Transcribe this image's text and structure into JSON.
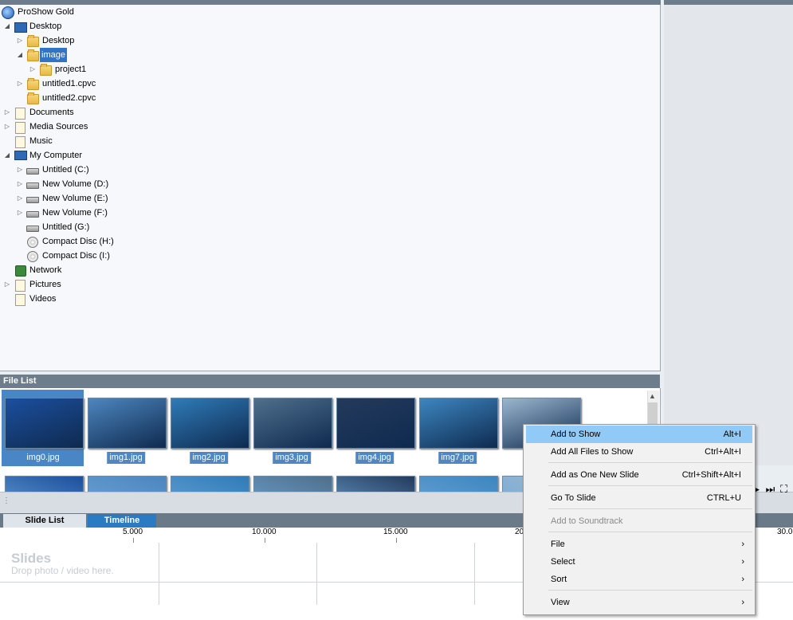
{
  "tree": [
    {
      "label": "ProShow Gold",
      "icon": "proshow-icon",
      "exp": ""
    },
    {
      "label": "Desktop",
      "icon": "desktop-icon",
      "exp": "◢"
    },
    {
      "label": "Desktop",
      "icon": "folder-icon",
      "exp": "▷"
    },
    {
      "label": "image",
      "icon": "folder-icon",
      "exp": "◢"
    },
    {
      "label": "project1",
      "icon": "folder-icon",
      "exp": "▷"
    },
    {
      "label": "untitled1.cpvc",
      "icon": "folder-icon",
      "exp": "▷"
    },
    {
      "label": "untitled2.cpvc",
      "icon": "folder-icon",
      "exp": ""
    },
    {
      "label": "Documents",
      "icon": "library-icon",
      "exp": "▷"
    },
    {
      "label": "Media Sources",
      "icon": "library-icon",
      "exp": "▷"
    },
    {
      "label": "Music",
      "icon": "library-icon",
      "exp": ""
    },
    {
      "label": "My Computer",
      "icon": "computer-icon",
      "exp": "◢"
    },
    {
      "label": "Untitled (C:)",
      "icon": "drive-icon",
      "exp": "▷"
    },
    {
      "label": "New Volume (D:)",
      "icon": "drive-icon",
      "exp": "▷"
    },
    {
      "label": "New Volume (E:)",
      "icon": "drive-icon",
      "exp": "▷"
    },
    {
      "label": "New Volume (F:)",
      "icon": "drive-icon",
      "exp": "▷"
    },
    {
      "label": "Untitled (G:)",
      "icon": "drive-icon",
      "exp": ""
    },
    {
      "label": "Compact Disc (H:)",
      "icon": "cd-icon",
      "exp": ""
    },
    {
      "label": "Compact Disc (I:)",
      "icon": "cd-icon",
      "exp": ""
    },
    {
      "label": "Network",
      "icon": "network-icon",
      "exp": ""
    },
    {
      "label": "Pictures",
      "icon": "library-icon",
      "exp": "▷"
    },
    {
      "label": "Videos",
      "icon": "library-icon",
      "exp": ""
    }
  ],
  "file_list": {
    "header": "File List",
    "files": [
      {
        "name": "img0.jpg",
        "color": "#1c4f9e"
      },
      {
        "name": "img1.jpg",
        "color": "#4d86bf"
      },
      {
        "name": "img2.jpg",
        "color": "#2f7bb8"
      },
      {
        "name": "img3.jpg",
        "color": "#4f6f8c"
      },
      {
        "name": "img4.jpg",
        "color": "#243a5c"
      },
      {
        "name": "img7.jpg",
        "color": "#3d86c0"
      },
      {
        "name": "",
        "color": "#9bb7cf"
      }
    ]
  },
  "tabs": {
    "slide_list": "Slide List",
    "timeline": "Timeline"
  },
  "ruler": [
    "5.000",
    "10.000",
    "15.000",
    "20",
    "30.0"
  ],
  "track": {
    "title": "Slides",
    "hint": "Drop photo / video here."
  },
  "transport": {
    "play": "▶",
    "end": "⏭",
    "fullscreen": "⛶"
  },
  "context_menu": [
    {
      "label": "Add to Show",
      "shortcut": "Alt+I"
    },
    {
      "label": "Add All Files to Show",
      "shortcut": "Ctrl+Alt+I"
    },
    {
      "label": "Add as One New Slide",
      "shortcut": "Ctrl+Shift+Alt+I"
    },
    {
      "label": "Go To Slide",
      "shortcut": "CTRL+U"
    },
    {
      "label": "Add to Soundtrack",
      "shortcut": ""
    },
    {
      "label": "File",
      "shortcut": ""
    },
    {
      "label": "Select",
      "shortcut": ""
    },
    {
      "label": "Sort",
      "shortcut": ""
    },
    {
      "label": "View",
      "shortcut": ""
    }
  ],
  "submenu_arrow": "›"
}
